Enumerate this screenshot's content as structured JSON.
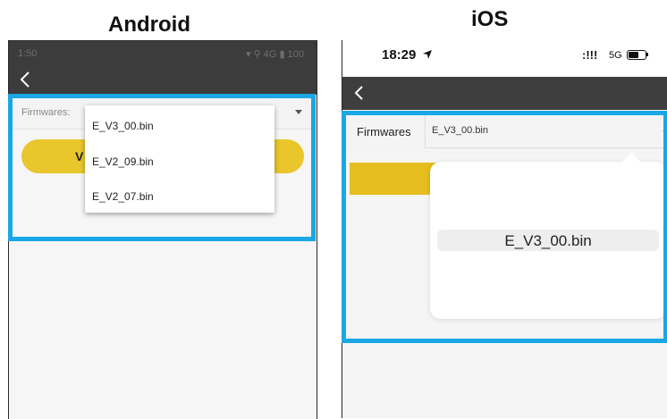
{
  "android": {
    "heading": "Android",
    "status": {
      "time": "1:50",
      "icons": "▾ ⚲ 4G ▮ 100"
    },
    "firmware_label": "Firmwares:",
    "update_button_label": "V",
    "dropdown_options": [
      "E_V3_00.bin",
      "E_V2_09.bin",
      "E_V2_07.bin"
    ]
  },
  "ios": {
    "heading": "iOS",
    "status": {
      "time": "18:29",
      "signal": ":!!!",
      "network": "5G"
    },
    "firmware_label": "Firmwares",
    "firmware_value": "E_V3_00.bin",
    "picker_selected": "E_V3_00.bin"
  },
  "colors": {
    "highlight": "#1aa7e6",
    "button_yellow": "#e8c62c",
    "appbar": "#3c3c3c"
  },
  "icons": [
    "back-arrow-icon",
    "dropdown-caret-icon",
    "location-arrow-icon",
    "battery-icon"
  ]
}
